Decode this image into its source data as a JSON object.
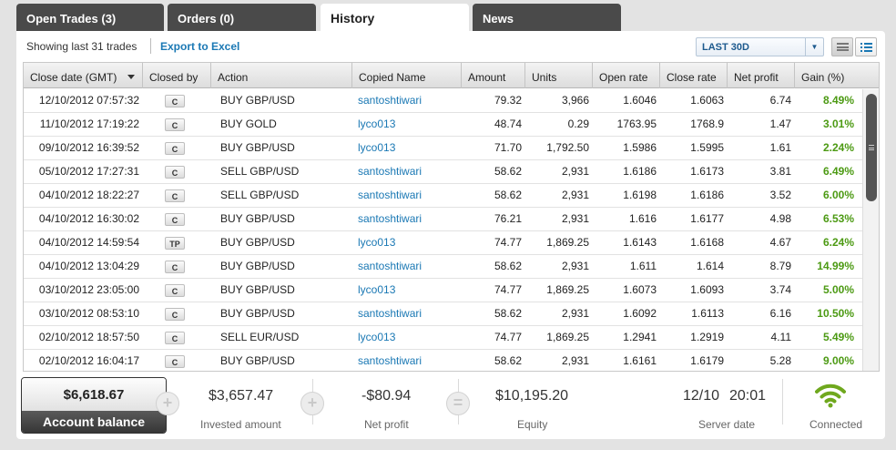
{
  "tabs": [
    {
      "label": "Open Trades (3)",
      "active": false
    },
    {
      "label": "Orders (0)",
      "active": false
    },
    {
      "label": "History",
      "active": true
    },
    {
      "label": "News",
      "active": false
    }
  ],
  "toolbar": {
    "showing_text": "Showing last 31 trades",
    "export_label": "Export to Excel",
    "range_value": "LAST 30D"
  },
  "table": {
    "columns": [
      "Close date (GMT)",
      "Closed by",
      "Action",
      "Copied Name",
      "Amount",
      "Units",
      "Open rate",
      "Close rate",
      "Net profit",
      "Gain (%)"
    ],
    "rows": [
      {
        "close_date": "12/10/2012 07:57:32",
        "closed_by": "C",
        "action": "BUY GBP/USD",
        "copied_name": "santoshtiwari",
        "amount": "79.32",
        "units": "3,966",
        "open_rate": "1.6046",
        "close_rate": "1.6063",
        "net_profit": "6.74",
        "gain": "8.49%"
      },
      {
        "close_date": "11/10/2012 17:19:22",
        "closed_by": "C",
        "action": "BUY GOLD",
        "copied_name": "lyco013",
        "amount": "48.74",
        "units": "0.29",
        "open_rate": "1763.95",
        "close_rate": "1768.9",
        "net_profit": "1.47",
        "gain": "3.01%"
      },
      {
        "close_date": "09/10/2012 16:39:52",
        "closed_by": "C",
        "action": "BUY GBP/USD",
        "copied_name": "lyco013",
        "amount": "71.70",
        "units": "1,792.50",
        "open_rate": "1.5986",
        "close_rate": "1.5995",
        "net_profit": "1.61",
        "gain": "2.24%"
      },
      {
        "close_date": "05/10/2012 17:27:31",
        "closed_by": "C",
        "action": "SELL GBP/USD",
        "copied_name": "santoshtiwari",
        "amount": "58.62",
        "units": "2,931",
        "open_rate": "1.6186",
        "close_rate": "1.6173",
        "net_profit": "3.81",
        "gain": "6.49%"
      },
      {
        "close_date": "04/10/2012 18:22:27",
        "closed_by": "C",
        "action": "SELL GBP/USD",
        "copied_name": "santoshtiwari",
        "amount": "58.62",
        "units": "2,931",
        "open_rate": "1.6198",
        "close_rate": "1.6186",
        "net_profit": "3.52",
        "gain": "6.00%"
      },
      {
        "close_date": "04/10/2012 16:30:02",
        "closed_by": "C",
        "action": "BUY GBP/USD",
        "copied_name": "santoshtiwari",
        "amount": "76.21",
        "units": "2,931",
        "open_rate": "1.616",
        "close_rate": "1.6177",
        "net_profit": "4.98",
        "gain": "6.53%"
      },
      {
        "close_date": "04/10/2012 14:59:54",
        "closed_by": "TP",
        "action": "BUY GBP/USD",
        "copied_name": "lyco013",
        "amount": "74.77",
        "units": "1,869.25",
        "open_rate": "1.6143",
        "close_rate": "1.6168",
        "net_profit": "4.67",
        "gain": "6.24%"
      },
      {
        "close_date": "04/10/2012 13:04:29",
        "closed_by": "C",
        "action": "BUY GBP/USD",
        "copied_name": "santoshtiwari",
        "amount": "58.62",
        "units": "2,931",
        "open_rate": "1.611",
        "close_rate": "1.614",
        "net_profit": "8.79",
        "gain": "14.99%"
      },
      {
        "close_date": "03/10/2012 23:05:00",
        "closed_by": "C",
        "action": "BUY GBP/USD",
        "copied_name": "lyco013",
        "amount": "74.77",
        "units": "1,869.25",
        "open_rate": "1.6073",
        "close_rate": "1.6093",
        "net_profit": "3.74",
        "gain": "5.00%"
      },
      {
        "close_date": "03/10/2012 08:53:10",
        "closed_by": "C",
        "action": "BUY GBP/USD",
        "copied_name": "santoshtiwari",
        "amount": "58.62",
        "units": "2,931",
        "open_rate": "1.6092",
        "close_rate": "1.6113",
        "net_profit": "6.16",
        "gain": "10.50%"
      },
      {
        "close_date": "02/10/2012 18:57:50",
        "closed_by": "C",
        "action": "SELL EUR/USD",
        "copied_name": "lyco013",
        "amount": "74.77",
        "units": "1,869.25",
        "open_rate": "1.2941",
        "close_rate": "1.2919",
        "net_profit": "4.11",
        "gain": "5.49%"
      },
      {
        "close_date": "02/10/2012 16:04:17",
        "closed_by": "C",
        "action": "BUY GBP/USD",
        "copied_name": "santoshtiwari",
        "amount": "58.62",
        "units": "2,931",
        "open_rate": "1.6161",
        "close_rate": "1.6179",
        "net_profit": "5.28",
        "gain": "9.00%"
      }
    ]
  },
  "footer": {
    "balance_value": "$6,618.67",
    "balance_label": "Account balance",
    "plus_symbol": "+",
    "equals_symbol": "=",
    "invested_value": "$3,657.47",
    "invested_label": "Invested amount",
    "netprofit_value": "-$80.94",
    "netprofit_label": "Net profit",
    "equity_value": "$10,195.20",
    "equity_label": "Equity",
    "server_date": "12/10",
    "server_time": "20:01",
    "server_label": "Server date",
    "connection_label": "Connected"
  },
  "colors": {
    "accent": "#1a78b4",
    "gain": "#4c9a13",
    "connected": "#6fa81e"
  },
  "icons": [
    "sort-caret-icon",
    "dropdown-caret-icon",
    "list-view-icon",
    "detail-view-icon",
    "plus-icon",
    "equals-icon",
    "wifi-icon",
    "scroll-grip-icon"
  ]
}
